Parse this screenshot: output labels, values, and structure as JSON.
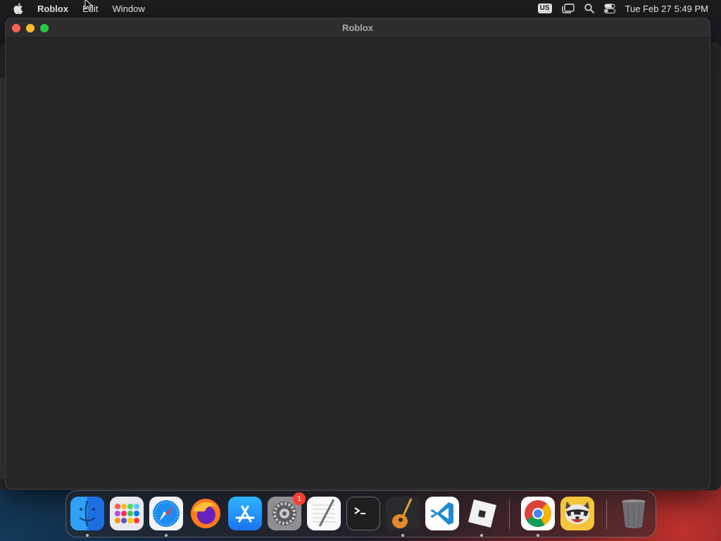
{
  "menubar": {
    "app_name": "Roblox",
    "items": [
      "Edit",
      "Window"
    ],
    "keyboard_layout": "US",
    "clock": {
      "date": "Tue Feb 27",
      "time": "5:49 PM"
    }
  },
  "window": {
    "title": "Roblox"
  },
  "dock": {
    "apps": [
      {
        "name": "finder-icon",
        "running": true
      },
      {
        "name": "launchpad-icon",
        "running": false
      },
      {
        "name": "safari-icon",
        "running": true
      },
      {
        "name": "firefox-icon",
        "running": false
      },
      {
        "name": "app-store-icon",
        "running": false
      },
      {
        "name": "system-settings-icon",
        "running": false,
        "badge": "1"
      },
      {
        "name": "textedit-icon",
        "running": false
      },
      {
        "name": "terminal-icon",
        "running": false
      },
      {
        "name": "garageband-icon",
        "running": true
      },
      {
        "name": "vscode-icon",
        "running": false
      },
      {
        "name": "roblox-icon",
        "running": true
      },
      {
        "name": "chrome-icon",
        "running": true
      },
      {
        "name": "raccoon-app-icon",
        "running": false
      },
      {
        "name": "trash-icon",
        "running": false
      }
    ]
  },
  "colors": {
    "close": "#fe5f57",
    "minimize": "#febc2e",
    "maximize": "#28c840",
    "window_bg": "#262626"
  }
}
